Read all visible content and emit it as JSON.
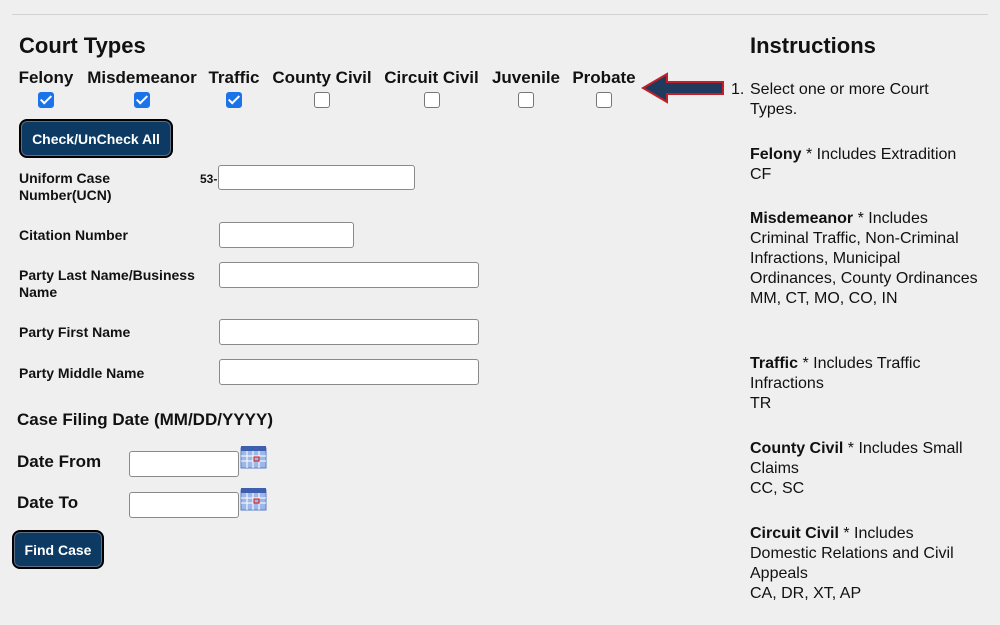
{
  "court_types": {
    "title": "Court Types",
    "items": [
      {
        "label": "Felony",
        "checked": true
      },
      {
        "label": "Misdemeanor",
        "checked": true
      },
      {
        "label": "Traffic",
        "checked": true
      },
      {
        "label": "County Civil",
        "checked": false
      },
      {
        "label": "Circuit Civil",
        "checked": false
      },
      {
        "label": "Juvenile",
        "checked": false
      },
      {
        "label": "Probate",
        "checked": false
      }
    ],
    "check_all_label": "Check/UnCheck All"
  },
  "form": {
    "ucn_label": "Uniform Case Number(UCN)",
    "ucn_prefix": "53-",
    "ucn_value": "",
    "citation_label": "Citation Number",
    "citation_value": "",
    "last_name_label": "Party Last Name/Business Name",
    "last_name_value": "",
    "first_name_label": "Party First Name",
    "first_name_value": "",
    "middle_name_label": "Party Middle Name",
    "middle_name_value": "",
    "filing_date_title": "Case Filing Date (MM/DD/YYYY)",
    "date_from_label": "Date From",
    "date_from_value": "",
    "date_to_label": "Date To",
    "date_to_value": "",
    "find_case_label": "Find Case"
  },
  "icons": {
    "calendar": "calendar-icon",
    "arrow": "arrow-left-icon"
  },
  "colors": {
    "button_bg": "#0d3a63",
    "checkbox_checked": "#1a73e8",
    "arrow_fill": "#1f3a5c",
    "arrow_stroke": "#c0202a"
  },
  "instructions": {
    "title": "Instructions",
    "step_number": "1.",
    "step_text": "Select one or more Court Types.",
    "entries": [
      {
        "name": "Felony",
        "desc": " * Includes Extradition",
        "codes": "CF"
      },
      {
        "name": "Misdemeanor",
        "desc": " * Includes Criminal Traffic, Non-Criminal Infractions, Municipal Ordinances, County Ordinances",
        "codes": "MM, CT, MO, CO, IN"
      },
      {
        "name": "Traffic",
        "desc": " * Includes Traffic Infractions",
        "codes": "TR"
      },
      {
        "name": "County Civil",
        "desc": " * Includes Small Claims",
        "codes": "CC, SC"
      },
      {
        "name": "Circuit Civil",
        "desc": " * Includes Domestic Relations and Civil Appeals",
        "codes": "CA, DR, XT, AP"
      }
    ]
  }
}
